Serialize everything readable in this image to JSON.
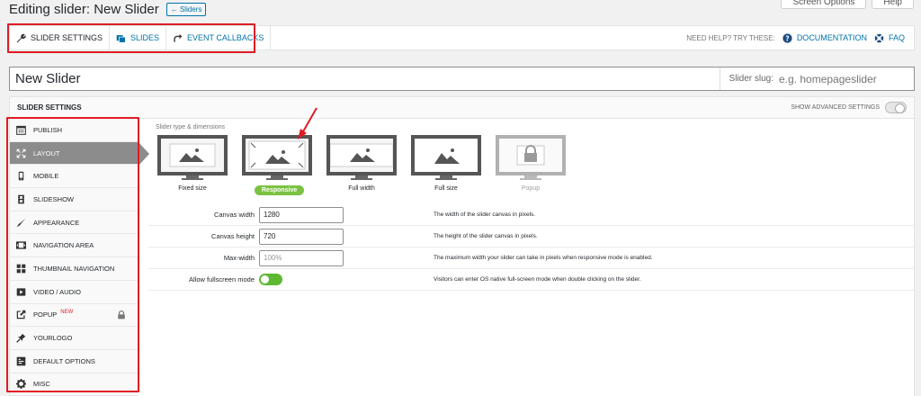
{
  "top_buttons": {
    "screen_options": "Screen Options",
    "help": "Help"
  },
  "header": {
    "title": "Editing slider: New Slider",
    "back_label": "← Sliders"
  },
  "toolbar": {
    "tabs": [
      {
        "label": "SLIDER SETTINGS",
        "icon": "wrench-icon"
      },
      {
        "label": "SLIDES",
        "icon": "slides-icon"
      },
      {
        "label": "EVENT CALLBACKS",
        "icon": "redo-arrow-icon"
      }
    ],
    "help_hint": "NEED HELP? TRY THESE:",
    "documentation": "DOCUMENTATION",
    "faq": "FAQ"
  },
  "slider": {
    "name": "New Slider",
    "slug_label": "Slider slug:",
    "slug_placeholder": "e.g. homepageslider"
  },
  "panel": {
    "title": "SLIDER SETTINGS",
    "advanced_label": "SHOW ADVANCED SETTINGS"
  },
  "sidebar": {
    "items": [
      {
        "label": "PUBLISH",
        "icon": "calendar-icon"
      },
      {
        "label": "LAYOUT",
        "icon": "resize-icon"
      },
      {
        "label": "MOBILE",
        "icon": "mobile-icon"
      },
      {
        "label": "SLIDESHOW",
        "icon": "film-icon"
      },
      {
        "label": "APPEARANCE",
        "icon": "brush-icon"
      },
      {
        "label": "NAVIGATION AREA",
        "icon": "navigation-icon"
      },
      {
        "label": "THUMBNAIL NAVIGATION",
        "icon": "grid-icon"
      },
      {
        "label": "VIDEO / AUDIO",
        "icon": "play-icon"
      },
      {
        "label": "POPUP",
        "icon": "external-icon",
        "badge": "NEW"
      },
      {
        "label": "YOURLOGO",
        "icon": "pin-icon"
      },
      {
        "label": "DEFAULT OPTIONS",
        "icon": "options-icon"
      },
      {
        "label": "MISC",
        "icon": "gear-icon"
      }
    ]
  },
  "layout": {
    "section_label": "Slider type & dimensions",
    "options": [
      {
        "label": "Fixed size"
      },
      {
        "label": "Responsive"
      },
      {
        "label": "Full width"
      },
      {
        "label": "Full size"
      },
      {
        "label": "Popup"
      }
    ]
  },
  "fields": {
    "canvas_width": {
      "label": "Canvas width",
      "value": "1280",
      "desc": "The width of the slider canvas in pixels."
    },
    "canvas_height": {
      "label": "Canvas height",
      "value": "720",
      "desc": "The height of the slider canvas in pixels."
    },
    "max_width": {
      "label": "Max-width",
      "placeholder": "100%",
      "desc": "The maximum width your slider can take in pixels when responsive mode is enabled."
    },
    "fullscreen": {
      "label": "Allow fullscreen mode",
      "desc": "Visitors can enter OS native full-screen mode when double clicking on the slider."
    }
  }
}
